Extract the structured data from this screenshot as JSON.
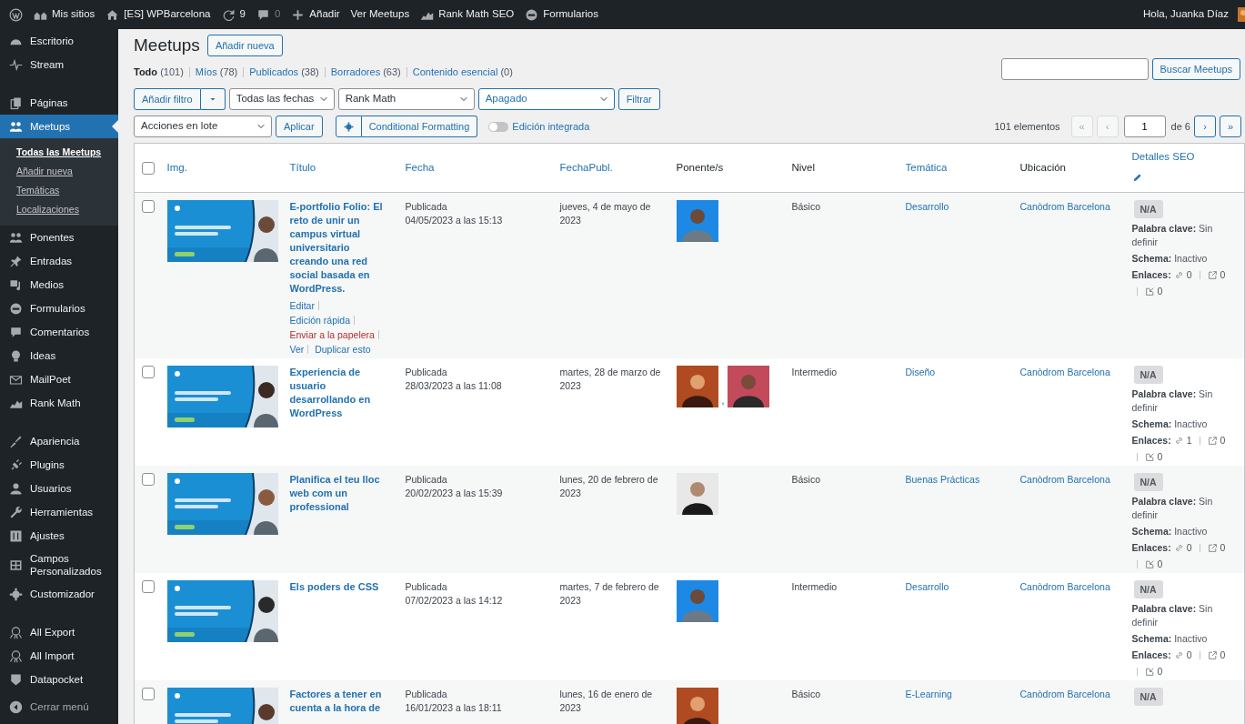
{
  "admin_bar": {
    "items": [
      {
        "label": "Mis sitios",
        "dimmed": false
      },
      {
        "label": "[ES] WPBarcelona",
        "dimmed": false
      },
      {
        "label": "9",
        "dimmed": false
      },
      {
        "label": "0",
        "dimmed": true
      },
      {
        "label": "Añadir",
        "dimmed": false
      },
      {
        "label": "Ver Meetups",
        "dimmed": false
      },
      {
        "label": "Rank Math SEO",
        "dimmed": false
      },
      {
        "label": "Formularios",
        "dimmed": false
      }
    ],
    "greeting": "Hola, Juanka Díaz"
  },
  "sidebar": {
    "groups": [
      [
        {
          "label": "Escritorio",
          "selected": false
        },
        {
          "label": "Stream",
          "selected": false
        }
      ],
      [
        {
          "label": "Páginas",
          "selected": false
        },
        {
          "label": "Meetups",
          "selected": true,
          "children": [
            {
              "label": "Todas las Meetups",
              "selected": true
            },
            {
              "label": "Añadir nueva",
              "selected": false
            },
            {
              "label": "Temáticas",
              "selected": false
            },
            {
              "label": "Localizaciones",
              "selected": false
            }
          ]
        },
        {
          "label": "Ponentes",
          "selected": false
        },
        {
          "label": "Entradas",
          "selected": false
        },
        {
          "label": "Medios",
          "selected": false
        },
        {
          "label": "Formularios",
          "selected": false
        },
        {
          "label": "Comentarios",
          "selected": false
        },
        {
          "label": "Ideas",
          "selected": false
        },
        {
          "label": "MailPoet",
          "selected": false
        },
        {
          "label": "Rank Math",
          "selected": false
        }
      ],
      [
        {
          "label": "Apariencia",
          "selected": false
        },
        {
          "label": "Plugins",
          "selected": false
        },
        {
          "label": "Usuarios",
          "selected": false
        },
        {
          "label": "Herramientas",
          "selected": false
        },
        {
          "label": "Ajustes",
          "selected": false
        },
        {
          "label": "Campos Personalizados",
          "selected": false
        },
        {
          "label": "Customizador",
          "selected": false
        }
      ],
      [
        {
          "label": "All Export",
          "selected": false
        },
        {
          "label": "All Import",
          "selected": false
        },
        {
          "label": "Datapocket",
          "selected": false
        }
      ]
    ],
    "collapse": "Cerrar menú"
  },
  "page": {
    "title": "Meetups",
    "add_button": "Añadir nueva"
  },
  "views": [
    {
      "label": "Todo",
      "count": "(101)",
      "selected": true
    },
    {
      "label": "Míos",
      "count": "(78)",
      "selected": false
    },
    {
      "label": "Publicados",
      "count": "(38)",
      "selected": false
    },
    {
      "label": "Borradores",
      "count": "(63)",
      "selected": false
    },
    {
      "label": "Contenido esencial",
      "count": "(0)",
      "selected": false
    }
  ],
  "search": {
    "button": "Buscar Meetups"
  },
  "filters": {
    "add_filter": "Añadir filtro",
    "selects": [
      {
        "value": "Todas las fechas",
        "active": false
      },
      {
        "value": "Rank Math",
        "active": false
      },
      {
        "value": "Apagado",
        "active": true
      }
    ],
    "button": "Filtrar"
  },
  "bulk": {
    "select": "Acciones en lote",
    "apply": "Aplicar",
    "format_button": "Conditional Formatting",
    "toggle": {
      "label": "Edición integrada",
      "on": false
    }
  },
  "pagination": {
    "count": "101 elementos",
    "page": "1",
    "of": "de 6",
    "buttons": [
      {
        "label": "«",
        "disabled": true
      },
      {
        "label": "‹",
        "disabled": true
      },
      {
        "label": "›",
        "disabled": false
      },
      {
        "label": "»",
        "disabled": false
      }
    ]
  },
  "table": {
    "select_all_checked": false,
    "columns": [
      {
        "label": "Img.",
        "sortable": true
      },
      {
        "label": "Título",
        "sortable": true
      },
      {
        "label": "Fecha",
        "sortable": true
      },
      {
        "label": "FechaPubl.",
        "sortable": true
      },
      {
        "label": "Ponente/s",
        "sortable": false
      },
      {
        "label": "Nivel",
        "sortable": false
      },
      {
        "label": "Temática",
        "sortable": true
      },
      {
        "label": "Ubicación",
        "sortable": false
      },
      {
        "label": "Detalles SEO",
        "sortable": true
      }
    ],
    "rows": [
      {
        "checked": false,
        "title": "E-portfolio Folio: El reto de unir un campus virtual universitario creando una red social basada en WordPress.",
        "actions": [
          {
            "label": "Editar",
            "kind": "link"
          },
          {
            "label": "Edición rápida",
            "kind": "link"
          },
          {
            "label": "Enviar a la papelera",
            "kind": "trash"
          },
          {
            "label": "Ver",
            "kind": "link"
          },
          {
            "label": "Duplicar esto",
            "kind": "link"
          }
        ],
        "status": "Publicada",
        "date": "04/05/2023 a las 15:13",
        "pub_date": "jueves, 4 de mayo de 2023",
        "level": "Básico",
        "topic": "Desarrollo",
        "location": "Canòdrom Barcelona",
        "seo": {
          "score": "N/A",
          "keyword": "**Palabra clave:** Sin definir",
          "schema": "**Schema:** Inactivo",
          "links_label": "Enlaces:",
          "internal": "0",
          "external": "0",
          "incoming": "0"
        }
      },
      {
        "checked": false,
        "title": "Experiencia de usuario desarrollando en WordPress",
        "status": "Publicada",
        "date": "28/03/2023 a las 11:08",
        "pub_date": "martes, 28 de marzo de 2023",
        "speaker_separator": ",",
        "level": "Intermedio",
        "topic": "Diseño",
        "location": "Canòdrom Barcelona",
        "seo": {
          "score": "N/A",
          "keyword": "**Palabra clave:** Sin definir",
          "schema": "**Schema:** Inactivo",
          "links_label": "Enlaces:",
          "internal": "1",
          "external": "0",
          "incoming": "0"
        }
      },
      {
        "checked": false,
        "title": "Planifica el teu lloc web com un professional",
        "status": "Publicada",
        "date": "20/02/2023 a las 15:39",
        "pub_date": "lunes, 20 de febrero de 2023",
        "level": "Básico",
        "topic": "Buenas Prácticas",
        "location": "Canòdrom Barcelona",
        "seo": {
          "score": "N/A",
          "keyword": "**Palabra clave:** Sin definir",
          "schema": "**Schema:** Inactivo",
          "links_label": "Enlaces:",
          "internal": "0",
          "external": "0",
          "incoming": "0"
        }
      },
      {
        "checked": false,
        "title": "Els poders de CSS",
        "status": "Publicada",
        "date": "07/02/2023 a las 14:12",
        "pub_date": "martes, 7 de febrero de 2023",
        "level": "Intermedio",
        "topic": "Desarrollo",
        "location": "Canòdrom Barcelona",
        "seo": {
          "score": "N/A",
          "keyword": "**Palabra clave:** Sin definir",
          "schema": "**Schema:** Inactivo",
          "links_label": "Enlaces:",
          "internal": "0",
          "external": "0",
          "incoming": "0"
        }
      },
      {
        "checked": false,
        "title": "Factores a tener en cuenta a la hora de",
        "status": "Publicada",
        "date": "16/01/2023 a las 18:11",
        "pub_date": "lunes, 16 de enero de 2023",
        "level": "Básico",
        "topic": "E-Learning",
        "location": "Canòdrom Barcelona",
        "seo": {
          "score": "N/A"
        }
      }
    ]
  }
}
